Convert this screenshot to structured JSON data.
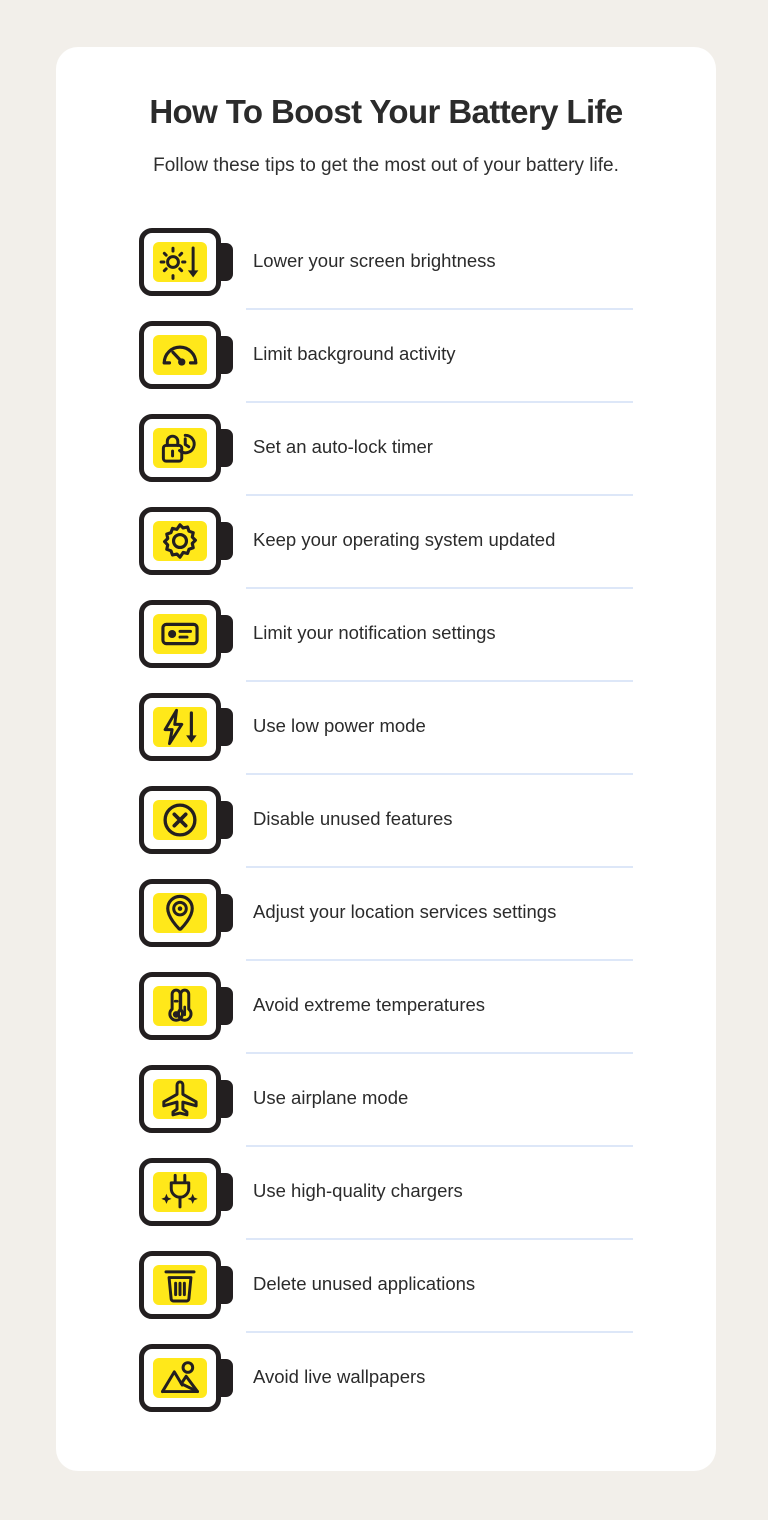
{
  "theme": {
    "page_background": "#f2efea",
    "card_background": "#ffffff",
    "accent_yellow": "#ffe81a",
    "outline_dark": "#231f20",
    "divider_blue": "#dde7f8",
    "text_dark": "#2b2b2b"
  },
  "header": {
    "title": "How To Boost Your Battery Life",
    "subtitle": "Follow these tips to get the most out of your battery life."
  },
  "tips": [
    {
      "label": "Lower your screen brightness",
      "icon": "brightness-down-icon"
    },
    {
      "label": "Limit background activity",
      "icon": "gauge-icon"
    },
    {
      "label": "Set an auto-lock timer",
      "icon": "lock-clock-icon"
    },
    {
      "label": "Keep your operating system updated",
      "icon": "gear-icon"
    },
    {
      "label": "Limit your notification settings",
      "icon": "notification-card-icon"
    },
    {
      "label": "Use low power mode",
      "icon": "bolt-down-arrow-icon"
    },
    {
      "label": "Disable unused features",
      "icon": "circle-x-icon"
    },
    {
      "label": "Adjust your location services settings",
      "icon": "location-pin-icon"
    },
    {
      "label": "Avoid extreme temperatures",
      "icon": "thermometers-icon"
    },
    {
      "label": "Use airplane mode",
      "icon": "airplane-icon"
    },
    {
      "label": "Use high-quality chargers",
      "icon": "plug-sparkle-icon"
    },
    {
      "label": "Delete unused applications",
      "icon": "trash-can-icon"
    },
    {
      "label": "Avoid live wallpapers",
      "icon": "image-photo-icon"
    }
  ]
}
